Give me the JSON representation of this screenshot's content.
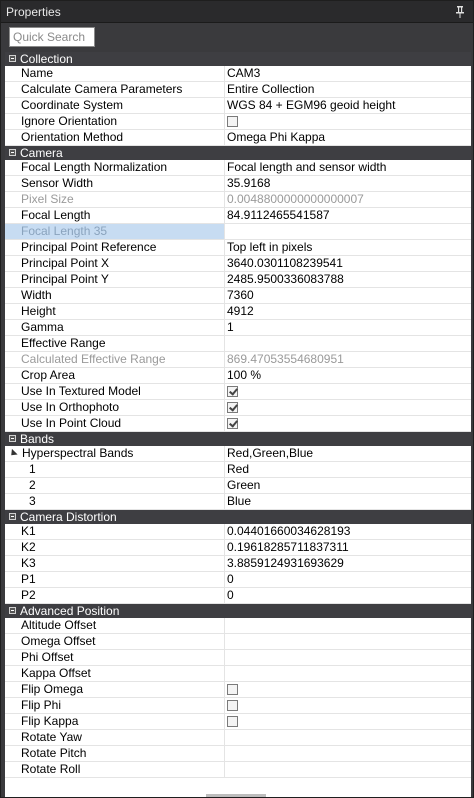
{
  "window": {
    "title": "Properties"
  },
  "search": {
    "placeholder": "Quick Search"
  },
  "sections": [
    {
      "label": "Collection",
      "rows": [
        {
          "name": "Name",
          "value": "CAM3"
        },
        {
          "name": "Calculate Camera Parameters",
          "value": "Entire Collection"
        },
        {
          "name": "Coordinate System",
          "value": "WGS 84 + EGM96 geoid height"
        },
        {
          "name": "Ignore Orientation",
          "checkbox": false
        },
        {
          "name": "Orientation Method",
          "value": "Omega Phi Kappa"
        }
      ]
    },
    {
      "label": "Camera",
      "rows": [
        {
          "name": "Focal Length Normalization",
          "value": "Focal length and sensor width"
        },
        {
          "name": "Sensor Width",
          "value": "35.9168"
        },
        {
          "name": "Pixel Size",
          "value": "0.0048800000000000007",
          "dim": true
        },
        {
          "name": "Focal Length",
          "value": "84.9112465541587"
        },
        {
          "name": "Focal Length 35",
          "value": "",
          "dim": true,
          "selected": true
        },
        {
          "name": "Principal Point Reference",
          "value": "Top left in pixels"
        },
        {
          "name": "Principal Point X",
          "value": "3640.0301108239541"
        },
        {
          "name": "Principal Point Y",
          "value": "2485.9500336083788"
        },
        {
          "name": "Width",
          "value": "7360"
        },
        {
          "name": "Height",
          "value": "4912"
        },
        {
          "name": "Gamma",
          "value": "1"
        },
        {
          "name": "Effective Range",
          "value": ""
        },
        {
          "name": "Calculated Effective Range",
          "value": "869.47053554680951",
          "dim": true
        },
        {
          "name": "Crop Area",
          "value": "100 %"
        },
        {
          "name": "Use In Textured Model",
          "checkbox": true
        },
        {
          "name": "Use In Orthophoto",
          "checkbox": true
        },
        {
          "name": "Use In Point Cloud",
          "checkbox": true
        }
      ]
    },
    {
      "label": "Bands",
      "rows": [
        {
          "name": "Hyperspectral Bands",
          "value": "Red,Green,Blue",
          "expander": true
        },
        {
          "name": "1",
          "value": "Red",
          "child": true
        },
        {
          "name": "2",
          "value": "Green",
          "child": true
        },
        {
          "name": "3",
          "value": "Blue",
          "child": true
        }
      ]
    },
    {
      "label": "Camera Distortion",
      "rows": [
        {
          "name": "K1",
          "value": "0.04401660034628193"
        },
        {
          "name": "K2",
          "value": "0.19618285711837311"
        },
        {
          "name": "K3",
          "value": "3.8859124931693629"
        },
        {
          "name": "P1",
          "value": "0"
        },
        {
          "name": "P2",
          "value": "0"
        }
      ]
    },
    {
      "label": "Advanced Position",
      "rows": [
        {
          "name": "Altitude Offset",
          "value": ""
        },
        {
          "name": "Omega Offset",
          "value": ""
        },
        {
          "name": "Phi Offset",
          "value": ""
        },
        {
          "name": "Kappa Offset",
          "value": ""
        },
        {
          "name": "Flip Omega",
          "checkbox": false
        },
        {
          "name": "Flip Phi",
          "checkbox": false
        },
        {
          "name": "Flip Kappa",
          "checkbox": false
        },
        {
          "name": "Rotate Yaw",
          "value": ""
        },
        {
          "name": "Rotate Pitch",
          "value": ""
        },
        {
          "name": "Rotate Roll",
          "value": ""
        }
      ]
    }
  ]
}
